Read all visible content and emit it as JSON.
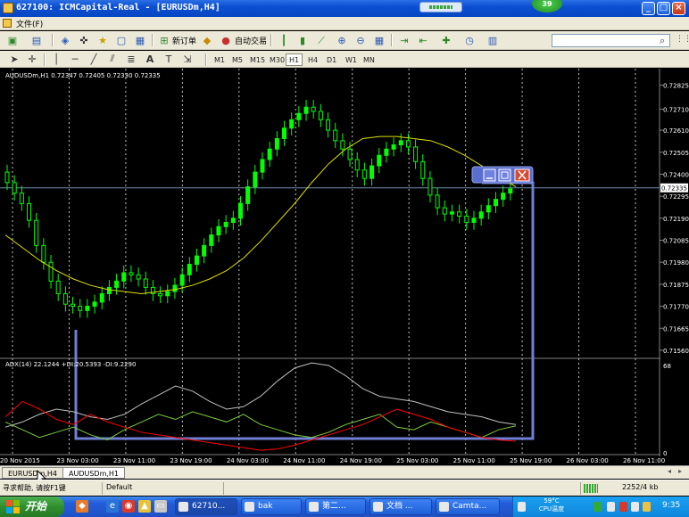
{
  "window": {
    "title": "627100: ICMCapital-Real - [EURUSDm,H4]",
    "notification_count": "39"
  },
  "menubar": {
    "file_label": "文件(F)"
  },
  "toolbar": {
    "new_order_label": "新订单",
    "auto_trade_label": "自动交易",
    "timeframes": [
      "M1",
      "M5",
      "M15",
      "M30",
      "H1",
      "H4",
      "D1",
      "W1",
      "MN"
    ],
    "active_timeframe": "H1",
    "search_placeholder": ""
  },
  "chart": {
    "header": "AUDUSDm,H1  0.72347 0.72405 0.72330 0.72335",
    "indicator_header": "ADX(14) 22.1244 +DI:20.5393 -DI:9.2290",
    "colors": {
      "background": "#000000",
      "bull": "#00ff00",
      "bear": "#000000",
      "ma": "#e0e000",
      "adx": "#c0c0c0",
      "plus_di": "#7ccd3a",
      "minus_di": "#ff0000",
      "window_rect": "#6f7fd6"
    }
  },
  "chart_data": [
    {
      "type": "candlestick",
      "title": "AUDUSDm,H1",
      "ylim": [
        0.7153,
        0.7284
      ],
      "y_ticks": [
        "0.72825",
        "0.72710",
        "0.72610",
        "0.72505",
        "0.72400",
        "0.72295",
        "0.72190",
        "0.72085",
        "0.71980",
        "0.71875",
        "0.71770",
        "0.71665",
        "0.71560"
      ],
      "current_price": "0.72335",
      "x_ticks": [
        "20 Nov 2015",
        "23 Nov 03:00",
        "23 Nov 11:00",
        "23 Nov 19:00",
        "24 Nov 03:00",
        "24 Nov 11:00",
        "24 Nov 19:00",
        "25 Nov 03:00",
        "25 Nov 11:00",
        "25 Nov 19:00",
        "26 Nov 03:00",
        "26 Nov 11:00"
      ],
      "close_series": [
        0.7236,
        0.7231,
        0.7226,
        0.7218,
        0.7206,
        0.7198,
        0.7189,
        0.7183,
        0.7178,
        0.7177,
        0.7175,
        0.7177,
        0.7179,
        0.7183,
        0.7186,
        0.7189,
        0.7193,
        0.7192,
        0.719,
        0.7186,
        0.7183,
        0.7182,
        0.7184,
        0.7187,
        0.7192,
        0.7197,
        0.7201,
        0.7206,
        0.7211,
        0.7215,
        0.7217,
        0.7219,
        0.7226,
        0.7234,
        0.7241,
        0.7247,
        0.7252,
        0.7257,
        0.7262,
        0.7266,
        0.7269,
        0.7272,
        0.727,
        0.7266,
        0.7261,
        0.7256,
        0.7252,
        0.7247,
        0.7242,
        0.7238,
        0.7244,
        0.7249,
        0.7252,
        0.7254,
        0.7256,
        0.7253,
        0.7246,
        0.7238,
        0.723,
        0.7224,
        0.7221,
        0.7222,
        0.722,
        0.7217,
        0.7219,
        0.7222,
        0.7225,
        0.7228,
        0.7231,
        0.7233
      ],
      "ma_series": [
        0.7211,
        0.7205,
        0.7199,
        0.7194,
        0.719,
        0.7187,
        0.7185,
        0.7184,
        0.7183,
        0.7184,
        0.7185,
        0.7187,
        0.719,
        0.7194,
        0.72,
        0.7208,
        0.7217,
        0.7226,
        0.7236,
        0.7245,
        0.7252,
        0.7257,
        0.7258,
        0.7258,
        0.7257,
        0.7256,
        0.7253,
        0.7249,
        0.7244,
        0.7239,
        0.7234
      ]
    },
    {
      "type": "line",
      "title": "ADX(14)",
      "ylim": [
        0,
        68
      ],
      "y_ticks": [
        "68",
        "0"
      ],
      "series": [
        {
          "name": "ADX",
          "values": [
            20,
            24,
            30,
            34,
            32,
            28,
            26,
            30,
            38,
            45,
            52,
            48,
            40,
            34,
            36,
            44,
            56,
            66,
            70,
            68,
            60,
            50,
            44,
            42,
            40,
            36,
            32,
            30,
            28,
            24,
            22
          ]
        },
        {
          "name": "+DI",
          "values": [
            24,
            18,
            12,
            16,
            20,
            14,
            10,
            18,
            24,
            30,
            26,
            32,
            28,
            24,
            30,
            22,
            18,
            14,
            12,
            16,
            22,
            26,
            30,
            20,
            18,
            24,
            20,
            16,
            12,
            18,
            21
          ]
        },
        {
          "name": "-DI",
          "values": [
            28,
            40,
            34,
            26,
            22,
            30,
            24,
            20,
            16,
            14,
            12,
            10,
            8,
            6,
            4,
            2,
            3,
            6,
            10,
            14,
            18,
            22,
            28,
            34,
            30,
            26,
            20,
            16,
            12,
            10,
            9
          ]
        }
      ]
    }
  ],
  "tabs": [
    "EURUSDm,H4",
    "AUDUSDm,H1"
  ],
  "statusbar": {
    "help_text": "寻求帮助, 请按F1键",
    "profile": "Default",
    "traffic": "2252/4 kb"
  },
  "taskbar": {
    "start_label": "开始",
    "tasks": [
      "62710...",
      "bak",
      "第二...",
      "文档 ...",
      "Camta..."
    ],
    "cpu_temp": "59°C",
    "cpu_label": "CPU温度",
    "clock": "9:35"
  }
}
